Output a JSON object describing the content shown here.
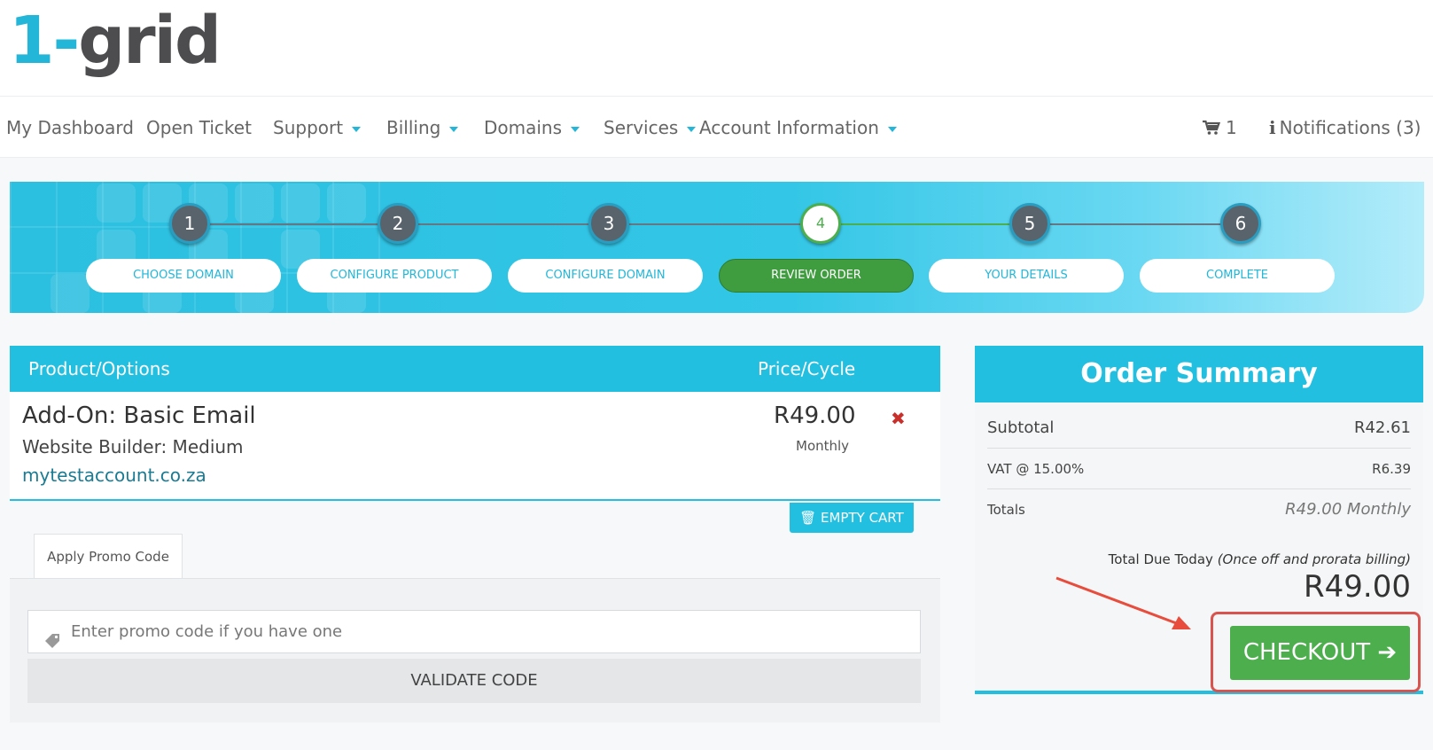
{
  "brand": {
    "logo_one": "1-",
    "logo_rest": "grid"
  },
  "nav": {
    "items": [
      {
        "label": "My Dashboard"
      },
      {
        "label": "Open Ticket"
      },
      {
        "label": "Support"
      },
      {
        "label": "Billing"
      },
      {
        "label": "Domains"
      },
      {
        "label": "Services"
      },
      {
        "label": "Account Information"
      }
    ],
    "cart_count": "1",
    "notifications": "Notifications (3)"
  },
  "steps": [
    {
      "number": "1",
      "label": "Choose Domain"
    },
    {
      "number": "2",
      "label": "Configure Product"
    },
    {
      "number": "3",
      "label": "Configure Domain"
    },
    {
      "number": "4",
      "label": "Review Order"
    },
    {
      "number": "5",
      "label": "Your Details"
    },
    {
      "number": "6",
      "label": "Complete"
    }
  ],
  "cart": {
    "col_product": "Product/Options",
    "col_price": "Price/Cycle",
    "item": {
      "name": "Add-On: Basic Email",
      "subtitle": "Website Builder: Medium",
      "domain": "mytestaccount.co.za",
      "price": "R49.00",
      "cycle": "Monthly"
    },
    "empty_cart_label": "EMPTY CART",
    "promo_tab_label": "Apply Promo Code",
    "promo_placeholder": "Enter promo code if you have one",
    "validate_label": "VALIDATE CODE"
  },
  "summary": {
    "title": "Order Summary",
    "subtotal_label": "Subtotal",
    "subtotal_value": "R42.61",
    "vat_label": "VAT @ 15.00%",
    "vat_value": "R6.39",
    "totals_label": "Totals",
    "totals_value": "R49.00 Monthly",
    "due_label": "Total Due Today",
    "due_note": "(Once off and prorata billing)",
    "due_amount": "R49.00",
    "checkout_label": "CHECKOUT"
  },
  "colors": {
    "brand_cyan": "#23bfe1",
    "success_green": "#4cae4c",
    "danger_red": "#d9534f"
  }
}
